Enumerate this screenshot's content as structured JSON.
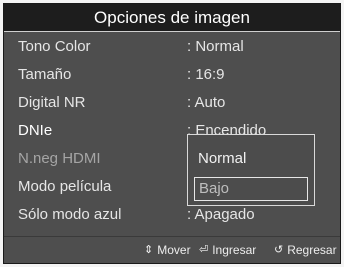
{
  "title": "Opciones de imagen",
  "settings": [
    {
      "label": "Tono Color",
      "value": ": Normal",
      "state": "normal"
    },
    {
      "label": "Tamaño",
      "value": ": 16:9",
      "state": "normal"
    },
    {
      "label": "Digital NR",
      "value": ": Auto",
      "state": "normal"
    },
    {
      "label": "DNIe",
      "value": ": Encendido",
      "state": "selected"
    },
    {
      "label": "N.neg HDMI",
      "value": "",
      "state": "disabled"
    },
    {
      "label": "Modo película",
      "value": "",
      "state": "normal"
    },
    {
      "label": "Sólo modo azul",
      "value": ": Apagado",
      "state": "normal"
    }
  ],
  "dropdown": {
    "options": [
      "Normal",
      "Bajo"
    ],
    "highlighted": "Bajo"
  },
  "bottom_bar": {
    "move_icon": "updown-arrows-icon",
    "move_label": "Mover",
    "enter_icon": "enter-icon",
    "enter_label": "Ingresar",
    "back_icon": "return-icon",
    "back_label": "Regresar"
  }
}
